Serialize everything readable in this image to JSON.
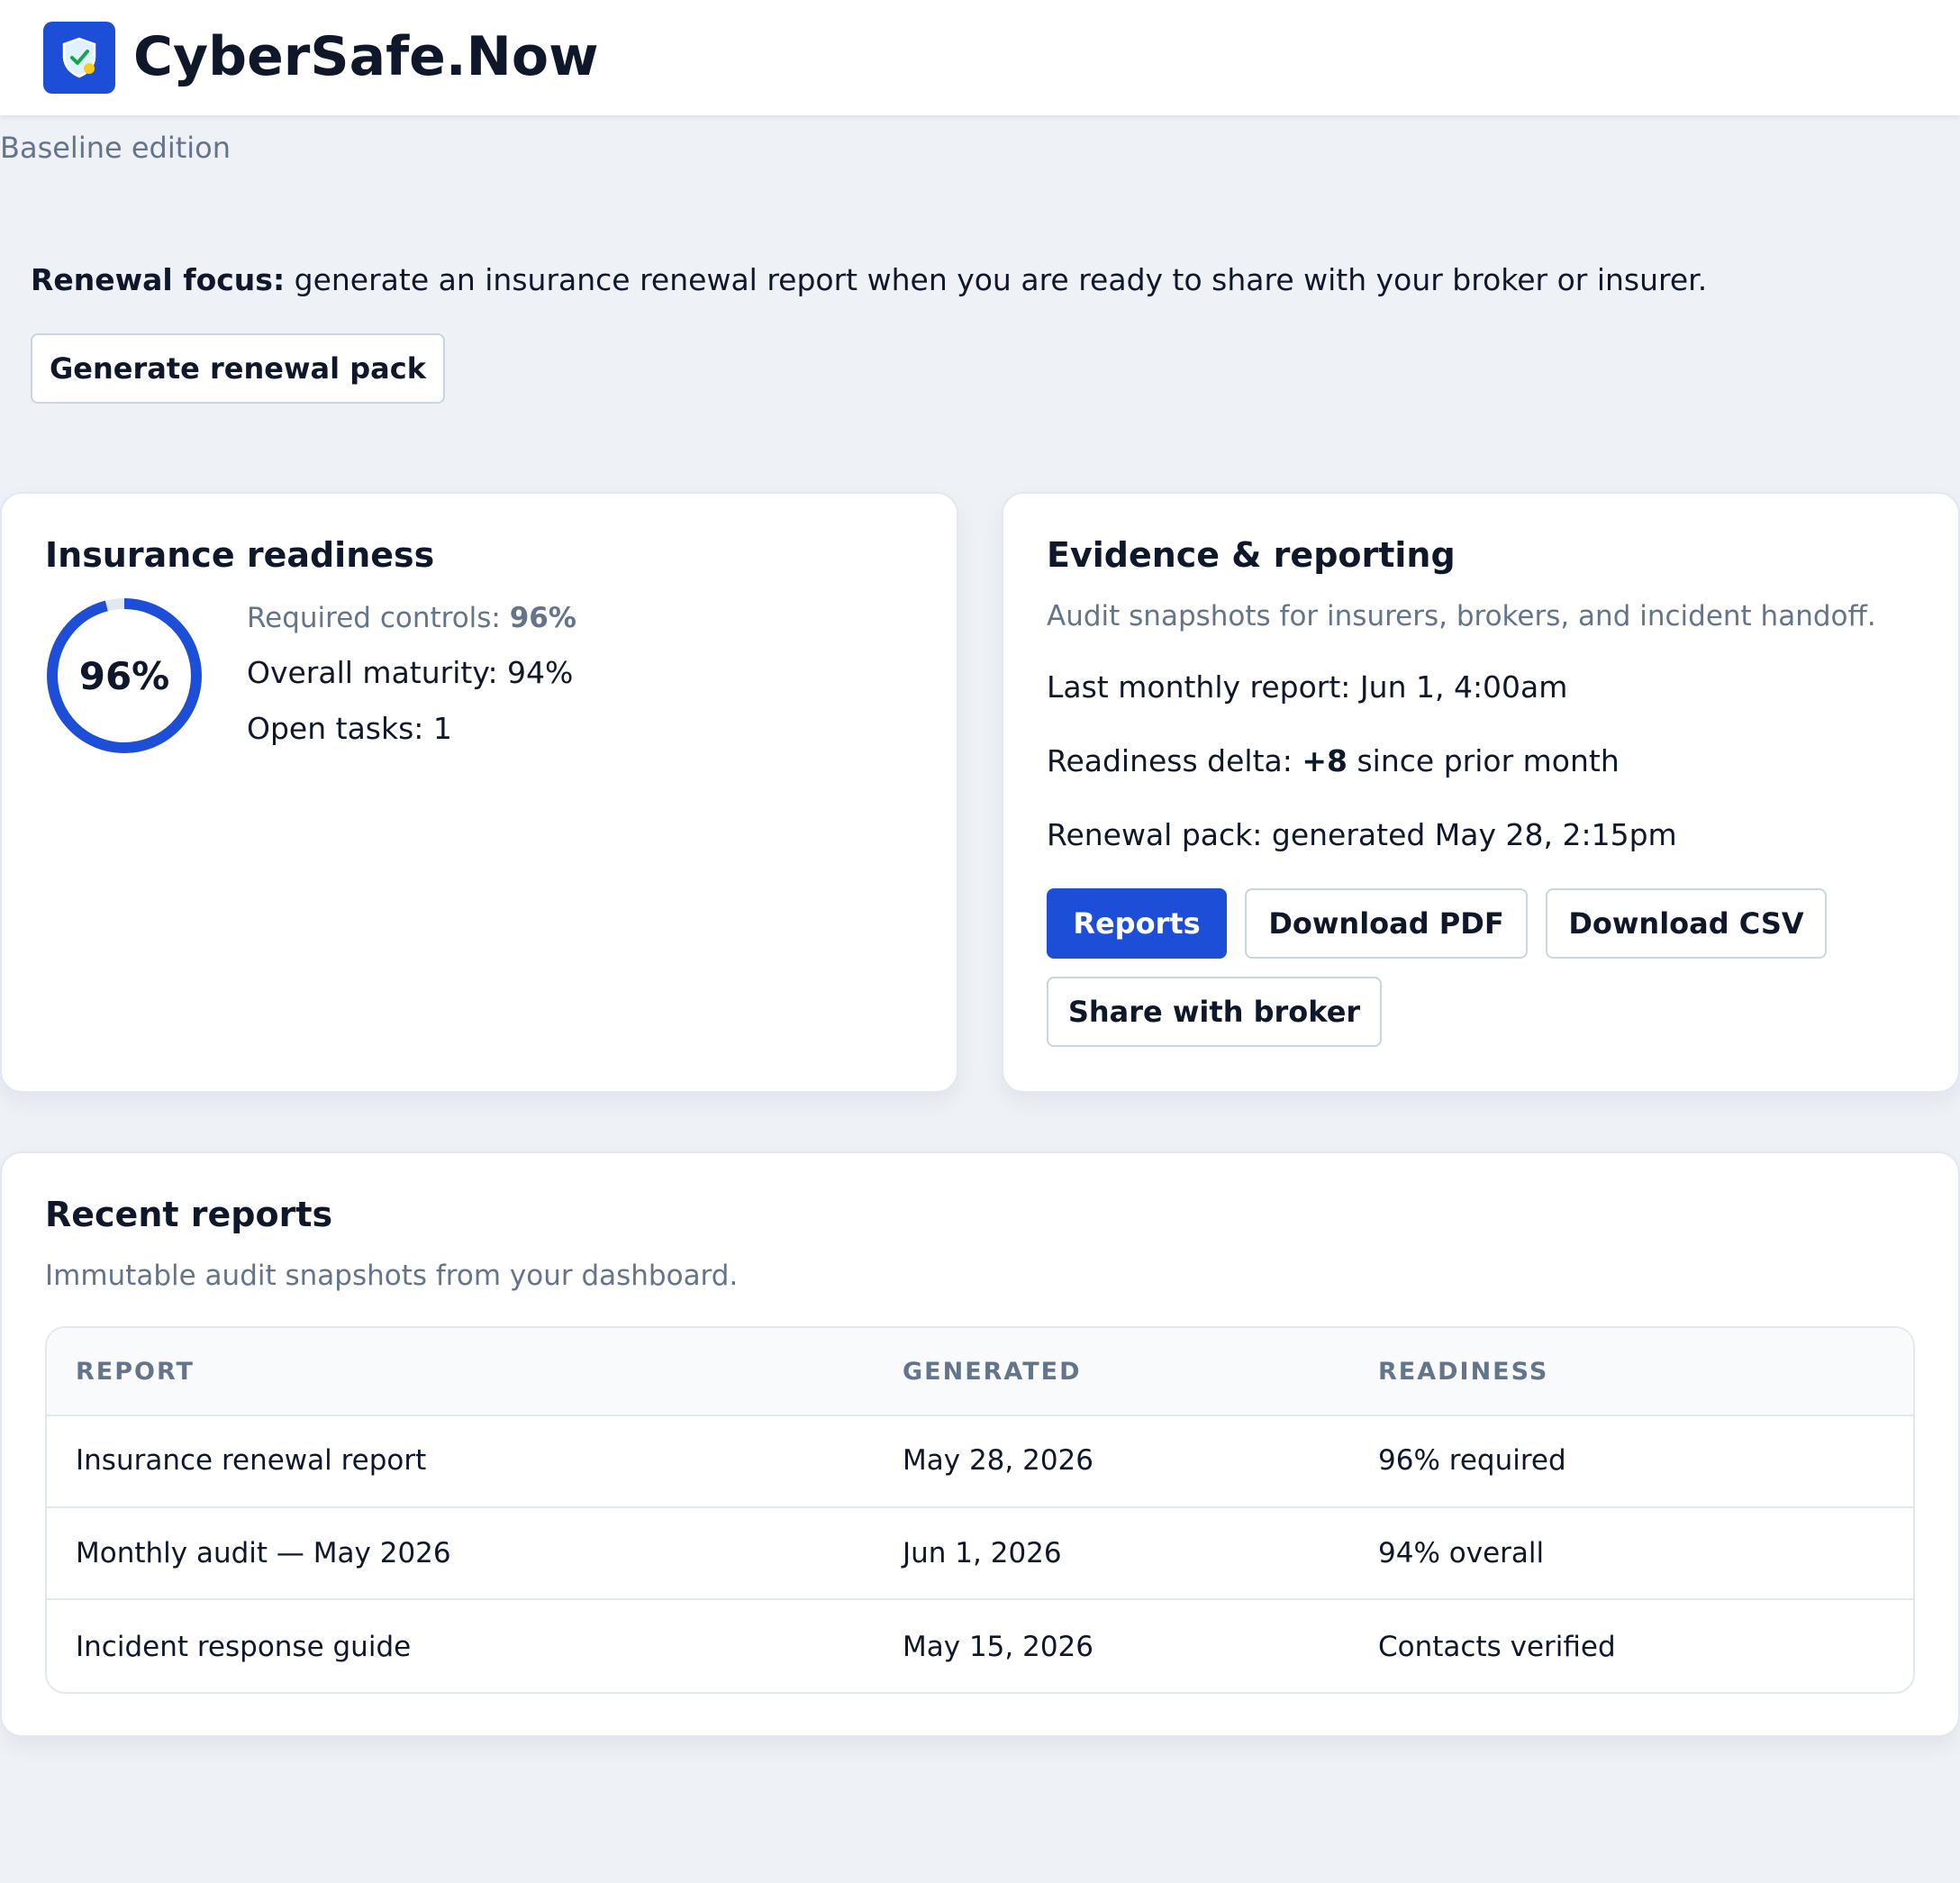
{
  "header": {
    "app_title": "CyberSafe.Now",
    "logo_icon": "shield-check-icon",
    "brand_color": "#1d4ed8"
  },
  "edition": "Baseline edition",
  "renewal_focus": {
    "label": "Renewal focus:",
    "text": " generate an insurance renewal report when you are ready to share with your broker or insurer.",
    "button_label": "Generate renewal pack"
  },
  "insurance_readiness": {
    "title": "Insurance readiness",
    "ring_percent": 96,
    "ring_label": "96%",
    "required_controls_label": "Required controls: ",
    "required_controls_value": "96%",
    "overall_maturity": "Overall maturity: 94%",
    "open_tasks": "Open tasks: 1"
  },
  "evidence_reporting": {
    "title": "Evidence & reporting",
    "subtitle": "Audit snapshots for insurers, brokers, and incident handoff.",
    "last_monthly_report": "Last monthly report: Jun 1, 4:00am",
    "readiness_delta_prefix": "Readiness delta: ",
    "readiness_delta_value": "+8",
    "readiness_delta_suffix": " since prior month",
    "renewal_pack": "Renewal pack: generated May 28, 2:15pm",
    "buttons": {
      "reports": "Reports",
      "download_pdf": "Download PDF",
      "download_csv": "Download CSV",
      "share_with_broker": "Share with broker"
    }
  },
  "recent_reports": {
    "title": "Recent reports",
    "subtitle": "Immutable audit snapshots from your dashboard.",
    "columns": [
      "REPORT",
      "GENERATED",
      "READINESS"
    ],
    "rows": [
      [
        "Insurance renewal report",
        "May 28, 2026",
        "96% required"
      ],
      [
        "Monthly audit — May 2026",
        "Jun 1, 2026",
        "94% overall"
      ],
      [
        "Incident response guide",
        "May 15, 2026",
        "Contacts verified"
      ]
    ]
  }
}
